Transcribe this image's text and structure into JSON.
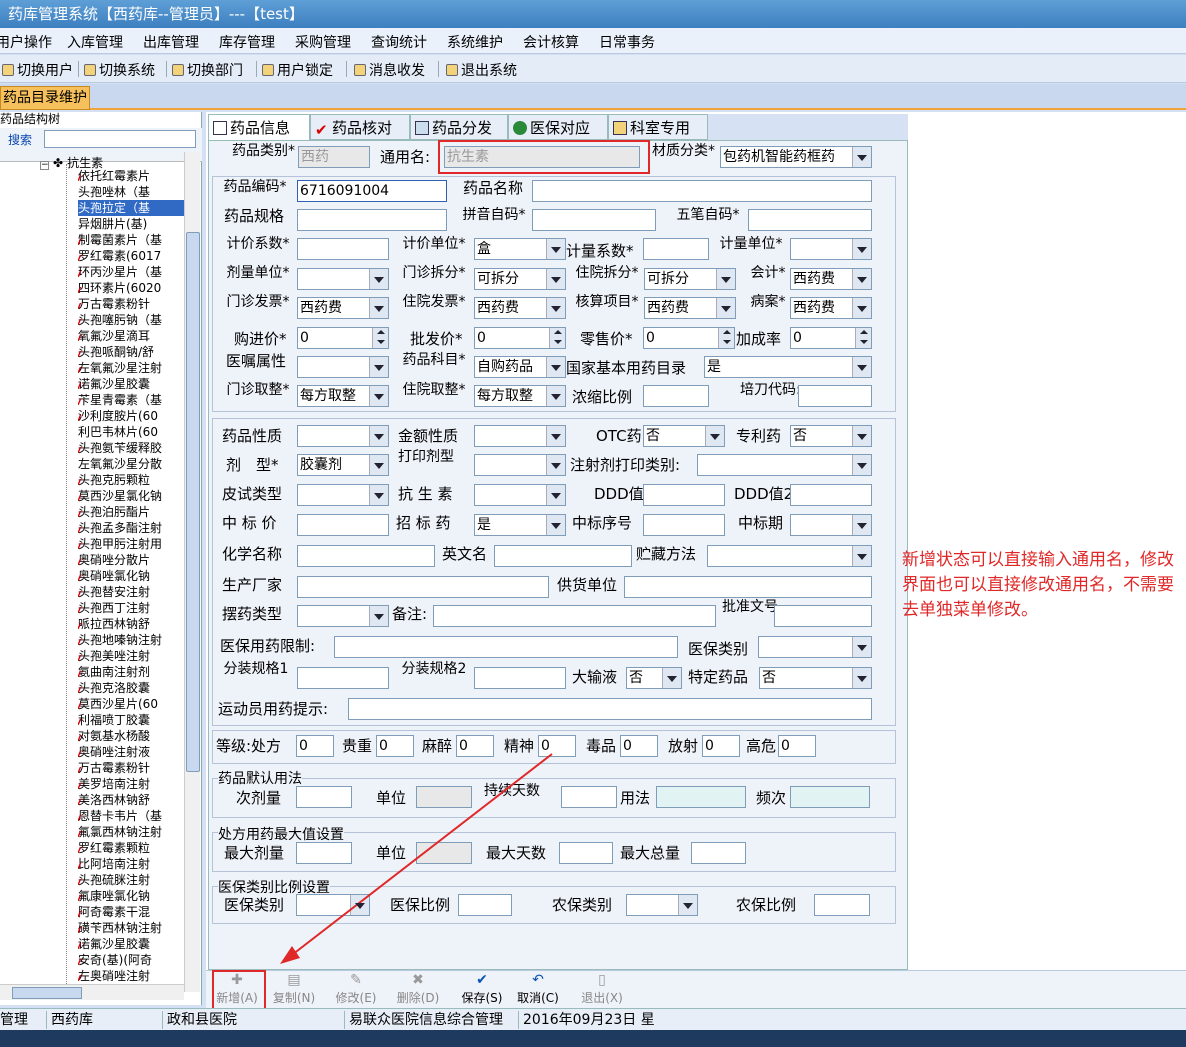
{
  "window": {
    "title": "药库管理系统【西药库--管理员】---【test】"
  },
  "menu": [
    "用户操作",
    "入库管理",
    "出库管理",
    "库存管理",
    "采购管理",
    "查询统计",
    "系统维护",
    "会计核算",
    "日常事务"
  ],
  "toolbar": [
    "切换用户",
    "切换系统",
    "切换部门",
    "用户锁定",
    "消息收发",
    "退出系统"
  ],
  "doc_tab": "药品目录维护",
  "left": {
    "title": "药品结构树",
    "search_label": "搜索",
    "root": "抗生素",
    "items": [
      "依托红霉素片",
      "头孢唑林（基",
      "头孢拉定（基",
      "异烟肼片(基)",
      "制霉菌素片（基",
      "罗红霉素(6017",
      "环丙沙星片（基",
      "四环素片(6020",
      "万古霉素粉针",
      "头孢噻肟钠（基",
      "氧氟沙星滴耳",
      "头孢哌酮钠/舒",
      "左氧氟沙星注射",
      "诺氟沙星胶囊",
      "苄星青霉素（基",
      "沙利度胺片(60",
      "利巴韦林片(60",
      "头孢氨苄缓释胶",
      "左氧氟沙星分散",
      "头孢克肟颗粒",
      "莫西沙星氯化钠",
      "头孢泊肟酯片",
      "头孢孟多酯注射",
      "头孢甲肟注射用",
      "奥硝唑分散片",
      "奥硝唑氯化钠",
      "头孢替安注射",
      "头孢西丁注射",
      "哌拉西林钠舒",
      "头孢地嗪钠注射",
      "头孢美唑注射",
      "氨曲南注射剂",
      "头孢克洛胶囊",
      "莫西沙星片(60",
      "利福喷丁胶囊",
      "对氨基水杨酸",
      "奥硝唑注射液",
      "万古霉素粉针",
      "美罗培南注射",
      "美洛西林钠舒",
      "恩替卡韦片（基",
      "氟氯西林钠注射",
      "罗红霉素颗粒",
      "比阿培南注射",
      "头孢硫脒注射",
      "氟康唑氯化钠",
      "阿奇霉素干混",
      "磺苄西林钠注射",
      "诺氟沙星胶囊",
      "安奇(基)(阿奇",
      "左奥硝唑注射"
    ]
  },
  "tabs": [
    "药品信息",
    "药品核对",
    "药品分发",
    "医保对应",
    "科室专用"
  ],
  "form": {
    "l_type": "药品类别*",
    "v_type": "西药",
    "l_common": "通用名:",
    "v_common": "抗生素",
    "l_material": "材质分类*",
    "v_material": "包药机智能药框药",
    "l_code": "药品编码*",
    "v_code": "6716091004",
    "l_name": "药品名称",
    "l_spec": "药品规格",
    "l_py": "拼音自码*",
    "l_wb": "五笔自码*",
    "l_pricecoef": "计价系数*",
    "l_priceunit": "计价单位*",
    "v_priceunit": "盒",
    "l_qtycoef": "计量系数*",
    "l_qtyunit": "计量单位*",
    "l_doseunit": "剂量单位*",
    "l_opsplit": "门诊拆分*",
    "v_opsplit": "可拆分",
    "l_ipsplit": "住院拆分*",
    "v_ipsplit": "可拆分",
    "l_acct": "会计*",
    "v_acct": "西药费",
    "l_opinv": "门诊发票*",
    "v_opinv": "西药费",
    "l_ipinv": "住院发票*",
    "v_ipinv": "西药费",
    "l_audit": "核算项目*",
    "v_audit": "西药费",
    "l_case": "病案*",
    "v_case": "西药费",
    "l_buy": "购进价*",
    "v_buy": "0",
    "l_whole": "批发价*",
    "v_whole": "0",
    "l_retail": "零售价*",
    "v_retail": "0",
    "l_markup": "加成率",
    "v_markup": "0",
    "l_order": "医嘱属性",
    "l_subject": "药品科目*",
    "v_subject": "自购药品",
    "l_basic": "国家基本用药目录",
    "v_basic": "是",
    "l_oproundup": "门诊取整*",
    "v_oproundup": "每方取整",
    "l_iproundup": "住院取整*",
    "v_iproundup": "每方取整",
    "l_conc": "浓缩比例",
    "l_mold": "培刀代码:",
    "l_prop": "药品性质",
    "l_amt": "金额性质",
    "l_otc": "OTC药",
    "v_otc": "否",
    "l_patent": "专利药",
    "v_patent": "否",
    "l_form": "剂　型*",
    "v_form": "胶囊剂",
    "l_printform": "打印剂型",
    "l_injprint": "注射剂打印类别:",
    "l_skin": "皮试类型",
    "l_anti": "抗 生 素",
    "l_ddd": "DDD值",
    "l_ddd2": "DDD值2",
    "l_bidprice": "中 标 价",
    "l_tender": "招 标 药",
    "v_tender": "是",
    "l_bidno": "中标序号",
    "l_bidperiod": "中标期",
    "l_chem": "化学名称",
    "l_en": "英文名",
    "l_store": "贮藏方法",
    "l_maker": "生产厂家",
    "l_supplier": "供货单位",
    "l_place": "摆药类型",
    "l_note": "备注:",
    "l_approve": "批准文号",
    "l_insr": "医保用药限制:",
    "l_insrtype": "医保类别",
    "l_pack1": "分装规格1",
    "l_pack2": "分装规格2",
    "l_infusion": "大输液",
    "v_infusion": "否",
    "l_special": "特定药品",
    "v_special": "否",
    "l_athlete": "运动员用药提示:",
    "l_level": "等级:处方",
    "v_level": "0",
    "l_precious": "贵重",
    "v_precious": "0",
    "l_narcotic": "麻醉",
    "v_narcotic": "0",
    "l_mental": "精神",
    "v_mental": "0",
    "l_toxic": "毒品",
    "v_toxic": "0",
    "l_radio": "放射",
    "v_radio": "0",
    "l_risk": "高危",
    "v_risk": "0",
    "g_usage": "药品默认用法",
    "l_dose": "次剂量",
    "l_unit": "单位",
    "l_days": "持续天数",
    "l_method": "用法",
    "l_freq": "频次",
    "g_max": "处方用药最大值设置",
    "l_maxdose": "最大剂量",
    "l_maxunit": "单位",
    "l_maxdays": "最大天数",
    "l_maxtotal": "最大总量",
    "g_ratio": "医保类别比例设置",
    "l_rinsr": "医保类别",
    "l_rratio": "医保比例",
    "l_rfarm": "农保类别",
    "l_rfarmratio": "农保比例"
  },
  "annotation": "新增状态可以直接输入通用名，修改界面也可以直接修改通用名，不需要去单独菜单修改。",
  "bottom_toolbar": [
    "新增(A)",
    "复制(N)",
    "修改(E)",
    "删除(D)",
    "保存(S)",
    "取消(C)",
    "退出(X)"
  ],
  "status": [
    "管理员",
    "西药库",
    "政和县医院",
    "易联众医院信息综合管理",
    "2016年09月23日 星"
  ],
  "colors": {
    "annotation": "#e02828",
    "selected": "#316ac5",
    "tab_active": "#f6c15d"
  }
}
